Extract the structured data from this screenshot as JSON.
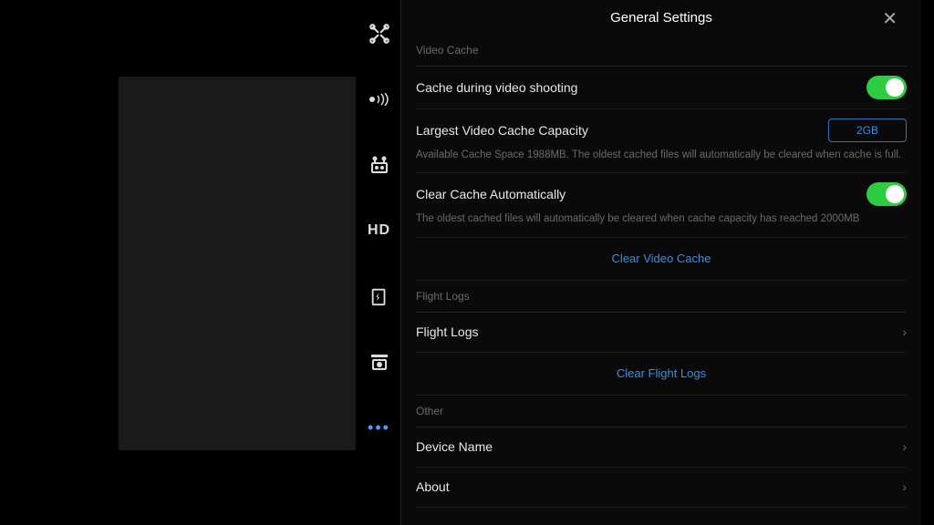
{
  "header": {
    "title": "General Settings"
  },
  "video_cache": {
    "section_label": "Video Cache",
    "cache_during_shooting": "Cache during video shooting",
    "largest_capacity_label": "Largest Video Cache Capacity",
    "largest_capacity_value": "2GB",
    "available_note": "Available Cache Space 1988MB. The oldest cached files will automatically be cleared when cache is full.",
    "clear_auto_label": "Clear Cache Automatically",
    "clear_auto_note": "The oldest cached files will automatically be cleared when cache capacity has reached 2000MB",
    "clear_video_cache": "Clear Video Cache"
  },
  "flight_logs": {
    "section_label": "Flight Logs",
    "flight_logs_label": "Flight Logs",
    "clear_flight_logs": "Clear Flight Logs"
  },
  "other": {
    "section_label": "Other",
    "device_name_label": "Device Name",
    "about_label": "About"
  },
  "sidebar": {
    "hd_label": "HD"
  }
}
